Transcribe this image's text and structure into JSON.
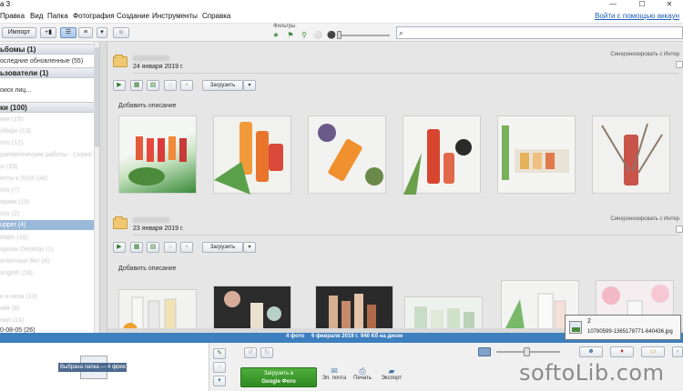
{
  "window": {
    "title": "а 3",
    "min": "—",
    "max": "☐",
    "close": "✕"
  },
  "menu": {
    "items": [
      "Правка",
      "Вид",
      "Папка",
      "Фотография",
      "Создание",
      "Инструменты",
      "Справка"
    ],
    "login_link": "Войти с помощью аккаун"
  },
  "toolbar": {
    "import_label": "Импорт",
    "filters_label": "Фильтры",
    "search_icon": "search-icon",
    "filter_icons": [
      "★",
      "⚑",
      "⚲",
      "⚪",
      "⚫"
    ]
  },
  "sidebar": {
    "headers": {
      "albums": "ьбомы (1)",
      "users": "ьзователи (1)",
      "folders": "ки (100)"
    },
    "recent": "оследние обновленные (55)",
    "face_search": "оиск лиц...",
    "selected_item": "upper (4)",
    "footer_item": "0-08-05 (26)",
    "blurred_items": [
      "ики (15)",
      "обери (13)",
      "ото (12)",
      "рапевтические работы - Серия 1 (9)",
      "ы (33)",
      "екты к 2018 (34)",
      "ото (7)",
      "ерхки (19)",
      "ото (2)",
      "etails (16)",
      "ороны Desktop (1)",
      "атентные бит (4)",
      "ongoth (18)",
      "и в неха (13)",
      "ийк (8)",
      "нал (14)"
    ]
  },
  "groups": [
    {
      "date": "24 января 2019 г.",
      "sync_label": "Синхронизировать с Интер",
      "upload_label": "Загрузить",
      "add_description": "Добавить описание",
      "photos": [
        "photo-juice-bottles",
        "photo-orange-bottles",
        "photo-lavender-bottle",
        "photo-red-bottle",
        "photo-giftbox",
        "photo-herbs-bottle"
      ]
    },
    {
      "date": "23 января 2019 г.",
      "sync_label": "Синхронизировать с Интер",
      "upload_label": "Загрузить",
      "add_description": "Добавить описание",
      "photos": [
        "photo-white-bottles",
        "photo-dark-flatlay",
        "photo-amber-set",
        "photo-pastel-set",
        "photo-white-set",
        "photo-floral-set"
      ]
    }
  ],
  "status": {
    "count": "4 фото",
    "date": "6 февраля 2019 г.",
    "size": "940 Кб на диске"
  },
  "tray": {
    "label": "Выбрана папка — 4 фото",
    "ghost": "фото"
  },
  "actions": {
    "google_upload": [
      "Загрузить в",
      "Google Фото"
    ],
    "email": "Эл. почта",
    "print": "Печать",
    "export": "Экспорт"
  },
  "popup": {
    "count": "2",
    "filename": "10780599-1365178771-640436.jpg"
  },
  "watermark": "softoLib.com",
  "colors": {
    "accent": "#3d7fbf",
    "selection": "#9ab9d8",
    "google_button": "#2f8a22"
  }
}
